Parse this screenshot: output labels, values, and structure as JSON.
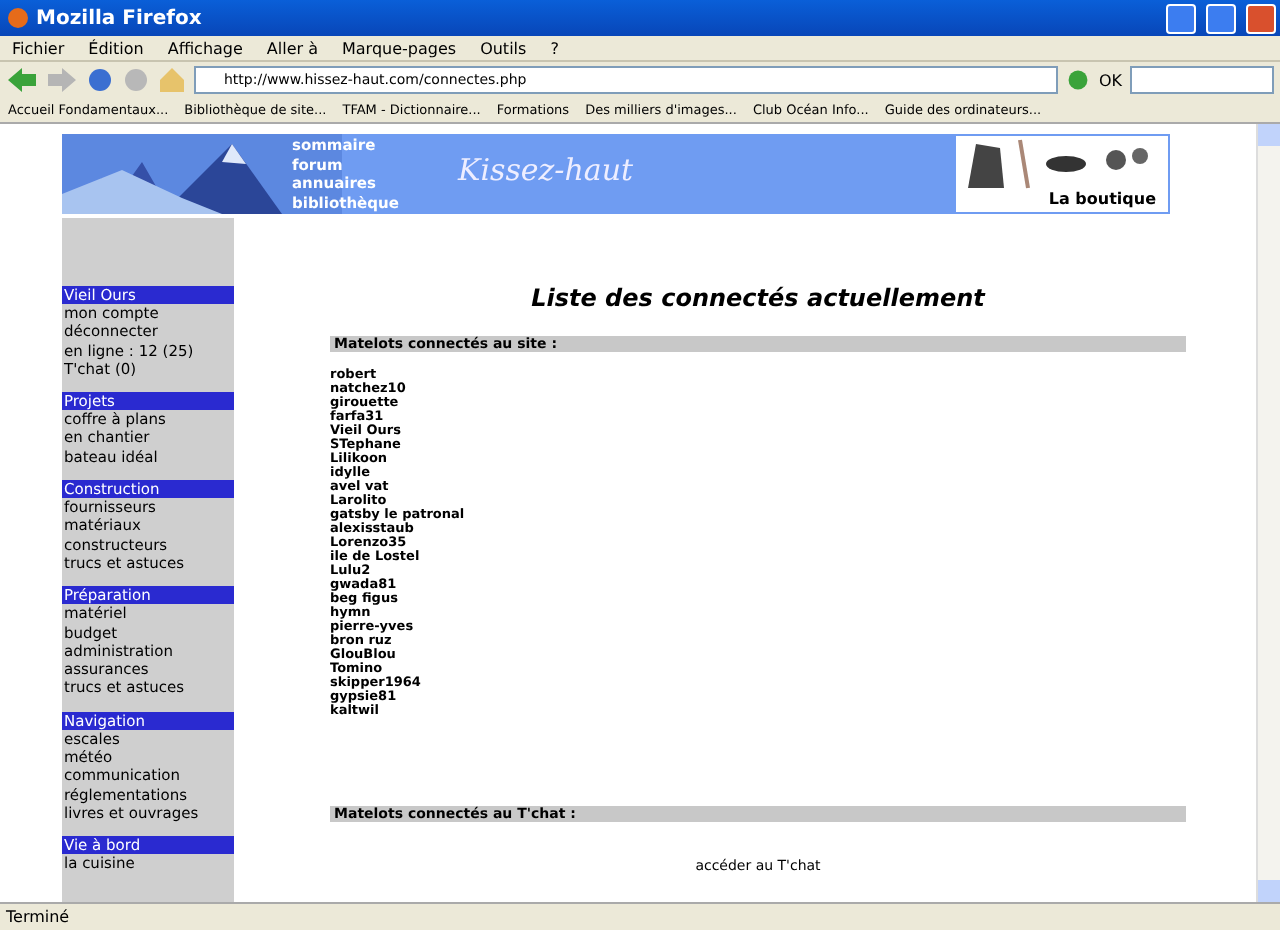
{
  "window": {
    "title": "Mozilla Firefox"
  },
  "menu": [
    "Fichier",
    "Édition",
    "Affichage",
    "Aller à",
    "Marque-pages",
    "Outils",
    "?"
  ],
  "toolbar": {
    "url": "http://www.hissez-haut.com/connectes.php",
    "go": "OK"
  },
  "bookmarks": [
    "Accueil Fondamentaux...",
    "Bibliothèque de site...",
    "TFAM - Dictionnaire...",
    "Formations",
    "Des milliers d'images...",
    "Club Océan Info...",
    "Guide des ordinateurs..."
  ],
  "banner": {
    "links": [
      "sommaire",
      "forum",
      "annuaires",
      "bibliothèque"
    ],
    "logo": "Kissez-haut",
    "shop": "La boutique"
  },
  "sidebar": [
    {
      "title": "Vieil Ours",
      "items": [
        "mon compte",
        "déconnecter",
        "en ligne : 12 (25)",
        "T'chat (0)"
      ]
    },
    {
      "title": "Projets",
      "items": [
        "coffre à plans",
        "en chantier",
        "bateau idéal"
      ]
    },
    {
      "title": "Construction",
      "items": [
        "fournisseurs",
        "matériaux",
        "constructeurs",
        "trucs et astuces"
      ]
    },
    {
      "title": "Préparation",
      "items": [
        "matériel",
        "budget",
        "administration",
        "assurances",
        "trucs et astuces"
      ]
    },
    {
      "title": "Navigation",
      "items": [
        "escales",
        "météo",
        "communication",
        "réglementations",
        "livres et ouvrages"
      ]
    },
    {
      "title": "Vie à bord",
      "items": [
        "la cuisine"
      ]
    }
  ],
  "main": {
    "title": "Liste des connectés actuellement",
    "site_header": "Matelots connectés au site :",
    "users": [
      "robert",
      "natchez10",
      "girouette",
      "farfa31",
      "Vieil Ours",
      "STephane",
      "Lilikoon",
      "idylle",
      "avel vat",
      "Larolito",
      "gatsby le patronal",
      "alexisstaub",
      "Lorenzo35",
      "ile de Lostel",
      "Lulu2",
      "gwada81",
      "beg figus",
      "hymn",
      "pierre-yves",
      "bron ruz",
      "GlouBlou",
      "Tomino",
      "skipper1964",
      "gypsie81",
      "kaltwil"
    ],
    "chat_header": "Matelots connectés au T'chat :",
    "chat_link": "accéder au T'chat"
  },
  "status_bar": "Terminé"
}
